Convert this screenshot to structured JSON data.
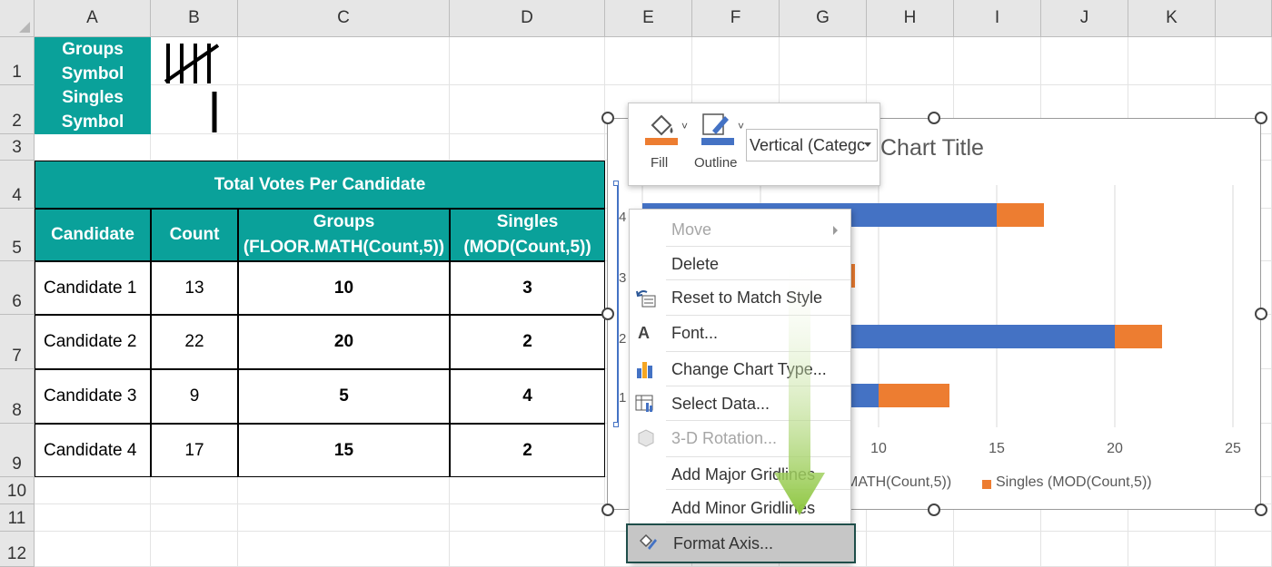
{
  "columns": [
    "A",
    "B",
    "C",
    "D",
    "E",
    "F",
    "G",
    "H",
    "I",
    "J",
    "K"
  ],
  "rows": [
    "1",
    "2",
    "3",
    "4",
    "5",
    "6",
    "7",
    "8",
    "9",
    "10",
    "11",
    "12"
  ],
  "labels": {
    "groups_symbol": "Groups Symbol",
    "singles_symbol": "Singles Symbol"
  },
  "table": {
    "title": "Total Votes Per Candidate",
    "headers": [
      "Candidate",
      "Count",
      "Groups (FLOOR.MATH(Count,5))",
      "Singles (MOD(Count,5))"
    ],
    "rows": [
      [
        "Candidate 1",
        "13",
        "10",
        "3"
      ],
      [
        "Candidate 2",
        "22",
        "20",
        "2"
      ],
      [
        "Candidate 3",
        "9",
        "5",
        "4"
      ],
      [
        "Candidate 4",
        "17",
        "15",
        "2"
      ]
    ]
  },
  "chart_data": {
    "type": "bar",
    "orientation": "horizontal",
    "stacked": true,
    "title": "Chart Title",
    "categories": [
      "1",
      "2",
      "3",
      "4"
    ],
    "series": [
      {
        "name": "Groups (FLOOR.MATH(Count,5))",
        "values": [
          10,
          20,
          5,
          15
        ],
        "color": "#4472c4"
      },
      {
        "name": "Singles (MOD(Count,5))",
        "values": [
          3,
          2,
          4,
          2
        ],
        "color": "#ed7d31"
      }
    ],
    "xlim": [
      0,
      25
    ],
    "visible_ticks": [
      "10",
      "15",
      "20",
      "25"
    ],
    "legend_text_visible": [
      "MATH(Count,5))",
      "Singles (MOD(Count,5))"
    ],
    "grid": true,
    "legend_position": "bottom"
  },
  "mini_toolbar": {
    "fill_label": "Fill",
    "outline_label": "Outline",
    "element_selector": "Vertical (Categc",
    "fill_color": "#ed7d31",
    "outline_color": "#4472c4"
  },
  "context_menu": {
    "items": [
      {
        "label": "Move",
        "disabled": true,
        "submenu": true,
        "icon": ""
      },
      {
        "label": "Delete",
        "disabled": false,
        "icon": ""
      },
      {
        "label": "Reset to Match Style",
        "disabled": false,
        "icon": "reset-style-icon"
      },
      {
        "label": "Font...",
        "disabled": false,
        "icon": "font-icon"
      },
      {
        "label": "Change Chart Type...",
        "disabled": false,
        "icon": "chart-type-icon"
      },
      {
        "label": "Select Data...",
        "disabled": false,
        "icon": "select-data-icon"
      },
      {
        "label": "3-D Rotation...",
        "disabled": true,
        "icon": "3d-rotation-icon"
      },
      {
        "label": "Add Major Gridlines",
        "disabled": false,
        "icon": ""
      },
      {
        "label": "Add Minor Gridlines",
        "disabled": false,
        "icon": ""
      },
      {
        "label": "Format Axis...",
        "disabled": false,
        "highlighted": true,
        "icon": "format-axis-icon"
      }
    ]
  },
  "colors": {
    "teal_header": "#0aa19a",
    "arrow_green": "#8dc63f"
  }
}
